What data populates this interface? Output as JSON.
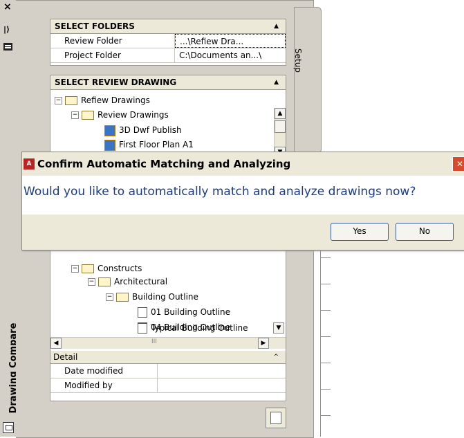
{
  "left_bar": {
    "title": "Drawing Compare",
    "close_glyph": "×",
    "pin_glyph": "|⟩"
  },
  "setup_tab": {
    "label": "Setup"
  },
  "select_folders": {
    "title": "SELECT FOLDERS",
    "rows": [
      {
        "label": "Review Folder",
        "value": "...\\Refiew Dra..."
      },
      {
        "label": "Project Folder",
        "value": "C:\\Documents an...\\"
      }
    ]
  },
  "select_review": {
    "title": "SELECT REVIEW DRAWING",
    "tree_top": [
      {
        "label": "Refiew Drawings",
        "kind": "folder",
        "level": 0,
        "expanded": true
      },
      {
        "label": "Review Drawings",
        "kind": "folder",
        "level": 1,
        "expanded": true
      },
      {
        "label": "3D Dwf Publish",
        "kind": "dwf",
        "level": 2
      },
      {
        "label": "First Floor Plan A1",
        "kind": "dwf",
        "level": 2
      }
    ],
    "tree_bottom": [
      {
        "label": "Constructs",
        "kind": "folder",
        "level": 1,
        "expanded": true
      },
      {
        "label": "Architectural",
        "kind": "folder",
        "level": 2,
        "expanded": true
      },
      {
        "label": "Building Outline",
        "kind": "folder",
        "level": 3,
        "expanded": true
      },
      {
        "label": "01 Building Outline",
        "kind": "building",
        "level": 4
      },
      {
        "label": "04 Building Outline",
        "kind": "building",
        "level": 4
      },
      {
        "label": "Typical Building Outline",
        "kind": "building",
        "level": 4
      }
    ],
    "scroll_mid": "III"
  },
  "detail": {
    "title": "Detail",
    "rows": [
      {
        "label": "Date modified",
        "value": ""
      },
      {
        "label": "Modified by",
        "value": ""
      }
    ]
  },
  "dialog": {
    "title": "Confirm Automatic Matching and Analyzing",
    "app_icon_text": "A",
    "message": "Would you like to automatically match and analyze drawings now?",
    "yes_label": "Yes",
    "no_label": "No"
  }
}
